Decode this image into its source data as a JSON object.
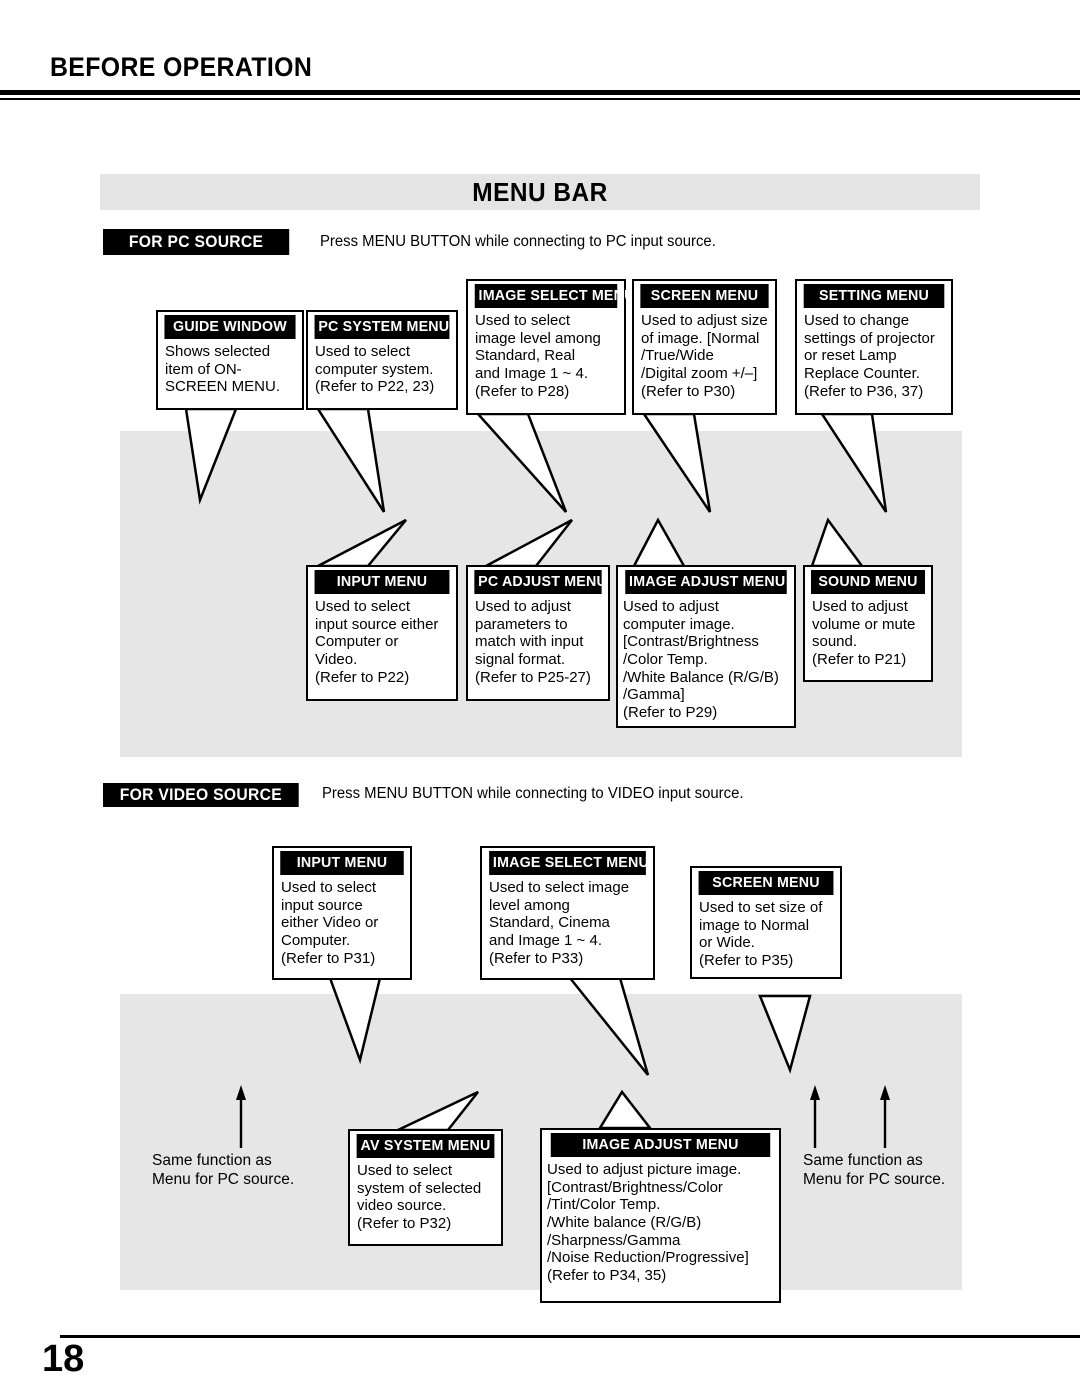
{
  "page": {
    "header_title": "BEFORE OPERATION",
    "section_title": "MENU BAR",
    "page_number": "18"
  },
  "pc_source": {
    "tag": "FOR PC SOURCE",
    "description": "Press MENU BUTTON while connecting to PC input source.",
    "top_row": [
      {
        "title": "GUIDE WINDOW",
        "body": "Shows selected\nitem of ON-\nSCREEN MENU."
      },
      {
        "title": "PC SYSTEM MENU",
        "body": "Used to select\ncomputer system.\n(Refer to P22, 23)"
      },
      {
        "title": "IMAGE SELECT MENU",
        "body": "Used to select\nimage level among\nStandard, Real\nand Image 1 ~ 4.\n(Refer to P28)"
      },
      {
        "title": "SCREEN MENU",
        "body": "Used to adjust size\nof image.  [Normal\n/True/Wide\n/Digital zoom +/–]\n(Refer to P30)"
      },
      {
        "title": "SETTING MENU",
        "body": "Used to change\nsettings of projector\nor reset Lamp\nReplace Counter.\n(Refer to P36, 37)"
      }
    ],
    "bottom_row": [
      {
        "title": "INPUT MENU",
        "body": "Used to select\ninput source either\nComputer or\nVideo.\n(Refer to P22)"
      },
      {
        "title": "PC ADJUST MENU",
        "body": "Used to adjust\nparameters to\nmatch with input\nsignal format.\n(Refer to P25-27)"
      },
      {
        "title": "IMAGE ADJUST MENU",
        "body": "Used to adjust\ncomputer image.\n[Contrast/Brightness\n /Color Temp.\n /White Balance (R/G/B)\n /Gamma]\n(Refer to P29)"
      },
      {
        "title": "SOUND MENU",
        "body": "Used to adjust\nvolume or mute\nsound.\n(Refer to P21)"
      }
    ]
  },
  "video_source": {
    "tag": "FOR VIDEO SOURCE",
    "description": "Press MENU BUTTON while connecting to VIDEO input source.",
    "top_row": [
      {
        "title": "INPUT MENU",
        "body": "Used to select\ninput source\neither Video or\nComputer.\n(Refer to P31)"
      },
      {
        "title": "IMAGE SELECT MENU",
        "body": "Used to select image\nlevel among\nStandard, Cinema\nand Image 1 ~ 4.\n(Refer to P33)"
      },
      {
        "title": "SCREEN MENU",
        "body": "Used to set size of\nimage to Normal\nor Wide.\n(Refer to P35)"
      }
    ],
    "bottom_row": [
      {
        "title": "AV SYSTEM MENU",
        "body": "Used to select\nsystem of selected\nvideo source.\n(Refer to P32)"
      },
      {
        "title": "IMAGE ADJUST MENU",
        "body": "Used to adjust picture image.\n[Contrast/Brightness/Color\n /Tint/Color Temp.\n /White balance (R/G/B)\n /Sharpness/Gamma\n /Noise Reduction/Progressive]\n(Refer to P34, 35)"
      }
    ],
    "notes": [
      "Same function as\nMenu for PC source.",
      "Same function as\nMenu for PC source."
    ]
  },
  "colors": {
    "band_grey": "#e4e4e4",
    "panel_grey": "#e6e6e6",
    "tag_black": "#000000",
    "text_black": "#000000"
  }
}
